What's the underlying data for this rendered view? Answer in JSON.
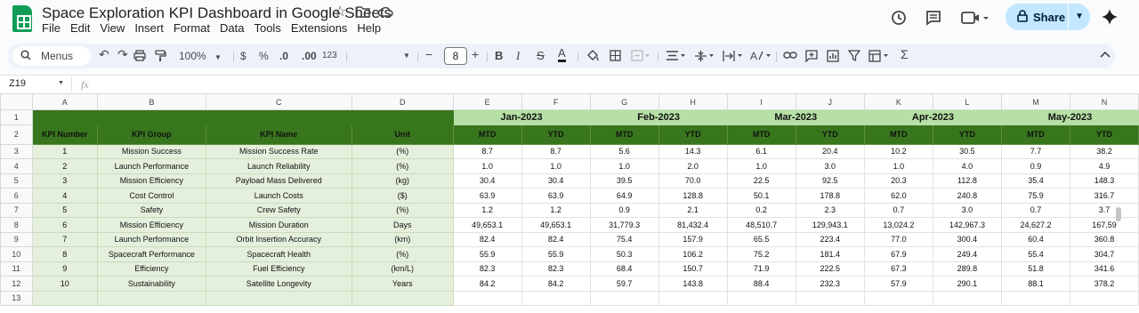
{
  "title": "Space Exploration KPI Dashboard in Google Sheets",
  "menu": [
    "File",
    "Edit",
    "View",
    "Insert",
    "Format",
    "Data",
    "Tools",
    "Extensions",
    "Help"
  ],
  "share_label": "Share",
  "toolbar": {
    "search_label": "Menus",
    "zoom": "100%",
    "currency": "$",
    "percent": "%",
    "dec_decrease": ".0",
    "dec_increase": ".00",
    "number_format": "123",
    "font_size": "8"
  },
  "name_box": "Z19",
  "fx": "fx",
  "columns": [
    "A",
    "B",
    "C",
    "D",
    "E",
    "F",
    "G",
    "H",
    "I",
    "J",
    "K",
    "L",
    "M",
    "N"
  ],
  "rows": [
    "1",
    "2",
    "3",
    "4",
    "5",
    "6",
    "7",
    "8",
    "9",
    "10",
    "11",
    "12",
    "13"
  ],
  "months": [
    "Jan-2023",
    "Feb-2023",
    "Mar-2023",
    "Apr-2023",
    "May-2023"
  ],
  "headers": {
    "kpi_number": "KPI Number",
    "kpi_group": "KPI Group",
    "kpi_name": "KPI Name",
    "unit": "Unit",
    "mtd": "MTD",
    "ytd": "YTD",
    "last_ytd": "YTD"
  },
  "kpis": [
    {
      "num": "1",
      "group": "Mission Success",
      "name": "Mission Success Rate",
      "unit": "(%)",
      "vals": [
        "8.7",
        "8.7",
        "5.6",
        "14.3",
        "6.1",
        "20.4",
        "10.2",
        "30.5",
        "7.7",
        "38.2"
      ]
    },
    {
      "num": "2",
      "group": "Launch Performance",
      "name": "Launch Reliability",
      "unit": "(%)",
      "vals": [
        "1.0",
        "1.0",
        "1.0",
        "2.0",
        "1.0",
        "3.0",
        "1.0",
        "4.0",
        "0.9",
        "4.9"
      ]
    },
    {
      "num": "3",
      "group": "Mission Efficiency",
      "name": "Payload Mass Delivered",
      "unit": "(kg)",
      "vals": [
        "30.4",
        "30.4",
        "39.5",
        "70.0",
        "22.5",
        "92.5",
        "20.3",
        "112.8",
        "35.4",
        "148.3"
      ]
    },
    {
      "num": "4",
      "group": "Cost Control",
      "name": "Launch Costs",
      "unit": "($)",
      "vals": [
        "63.9",
        "63.9",
        "64.9",
        "128.8",
        "50.1",
        "178.8",
        "62.0",
        "240.8",
        "75.9",
        "316.7"
      ]
    },
    {
      "num": "5",
      "group": "Safety",
      "name": "Crew Safety",
      "unit": "(%)",
      "vals": [
        "1.2",
        "1.2",
        "0.9",
        "2.1",
        "0.2",
        "2.3",
        "0.7",
        "3.0",
        "0.7",
        "3.7"
      ]
    },
    {
      "num": "6",
      "group": "Mission Efficiency",
      "name": "Mission Duration",
      "unit": "Days",
      "vals": [
        "49,653.1",
        "49,653.1",
        "31,779.3",
        "81,432.4",
        "48,510.7",
        "129,943.1",
        "13,024.2",
        "142,967.3",
        "24,627.2",
        "167,59"
      ]
    },
    {
      "num": "7",
      "group": "Launch Performance",
      "name": "Orbit Insertion Accuracy",
      "unit": "(km)",
      "vals": [
        "82.4",
        "82.4",
        "75.4",
        "157.9",
        "65.5",
        "223.4",
        "77.0",
        "300.4",
        "60.4",
        "360.8"
      ]
    },
    {
      "num": "8",
      "group": "Spacecraft Performance",
      "name": "Spacecraft Health",
      "unit": "(%)",
      "vals": [
        "55.9",
        "55.9",
        "50.3",
        "106.2",
        "75.2",
        "181.4",
        "67.9",
        "249.4",
        "55.4",
        "304.7"
      ]
    },
    {
      "num": "9",
      "group": "Efficiency",
      "name": "Fuel Efficiency",
      "unit": "(km/L)",
      "vals": [
        "82.3",
        "82.3",
        "68.4",
        "150.7",
        "71.9",
        "222.5",
        "67.3",
        "289.8",
        "51.8",
        "341.6"
      ]
    },
    {
      "num": "10",
      "group": "Sustainability",
      "name": "Satellite Longevity",
      "unit": "Years",
      "vals": [
        "84.2",
        "84.2",
        "59.7",
        "143.8",
        "88.4",
        "232.3",
        "57.9",
        "290.1",
        "88.1",
        "378.2"
      ]
    }
  ]
}
